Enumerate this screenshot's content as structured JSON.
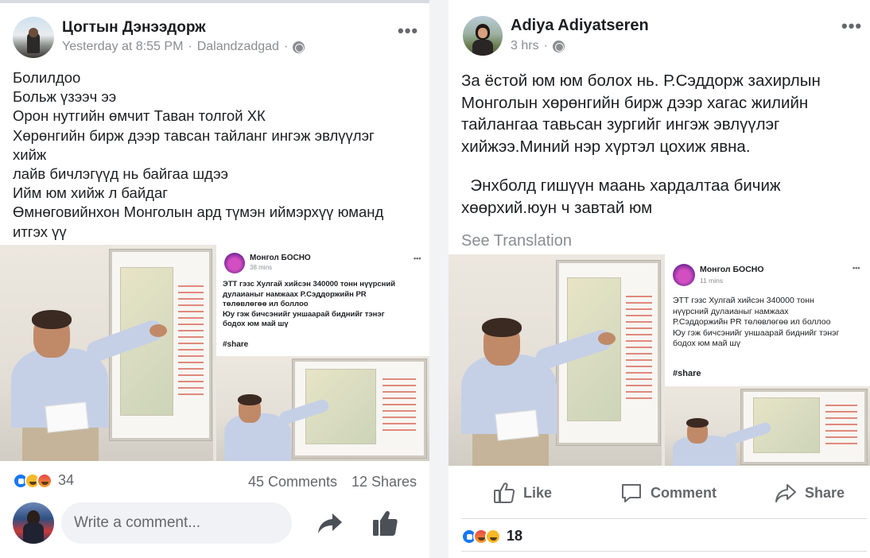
{
  "left_post": {
    "author": "Цогтын Дэнээдорж",
    "time": "Yesterday at 8:55 PM",
    "separator": "·",
    "location": "Dalandzadgad",
    "more": "•••",
    "body_lines": [
      "Болилдоо",
      "Больж үзээч ээ",
      "Орон нутгийн өмчит Таван толгой ХК",
      "Хөрөнгийн бирж дээр тавсан тайланг ингэж эвлүүлэг",
      "хийж",
      "лайв бичлэгүүд нь байгаа шдээ",
      "Ийм юм хийж л байдаг",
      "Өмнөговийнхон Монголын ард түмэн иймэрхүү юманд",
      "итгэх үү"
    ],
    "shared_card": {
      "page_name": "Монгол БОСНО",
      "time": "38 mins",
      "more": "•••",
      "text_lines": [
        "ЭТТ гэзс Хулгай хийсэн 340000 тонн нүүрсний",
        "дулаианыг намжаах Р.Сэддоржийн PR",
        "төлөвлөгөө ил боллоо",
        "Юу гэж бичсэнийг уншаарай биднийг тэнэг",
        "бодох юм май шү"
      ],
      "hashtag": "#share"
    },
    "reaction_count": "34",
    "comments": "45 Comments",
    "shares": "12 Shares",
    "comment_placeholder": "Write a comment..."
  },
  "right_post": {
    "author": "Adiya Adiyatseren",
    "time": "3 hrs",
    "separator": "·",
    "more": "•••",
    "body_lines": [
      "За ёстой юм юм болох нь. Р.Сэддорж захирлын",
      "Монголын хөрөнгийн бирж дээр хагас жилийн",
      "тайлангаа тавьсан зургийг ингэж эвлүүлэг",
      "хийжээ.Миний нэр хүртэл цохиж явна.",
      "",
      "  Энхболд гишүүн маань хардалтаа бичиж",
      "хөөрхий.юун ч завтай юм"
    ],
    "see_translation": "See Translation",
    "shared_card": {
      "page_name": "Монгол БОСНО",
      "time": "11 mins",
      "more": "•••",
      "text_lines": [
        "ЭТТ гэзс Хулгай хийсэн 340000 тонн",
        "нүүрсний  дулаианыг намжаах",
        "Р.Сэддоржийн PR  төлөвлөгөө ил боллоо",
        "Юу гэж бичсэнийг уншаарай биднийг тэнэг",
        "бодох юм май шү"
      ],
      "hashtag": "#share"
    },
    "actions": {
      "like": "Like",
      "comment": "Comment",
      "share": "Share"
    },
    "reaction_count": "18"
  },
  "colors": {
    "fb_blue": "#1877f2",
    "meta_gray": "#8a8d91",
    "text": "#1c1e21",
    "comment_bg": "#f0f2f5"
  }
}
